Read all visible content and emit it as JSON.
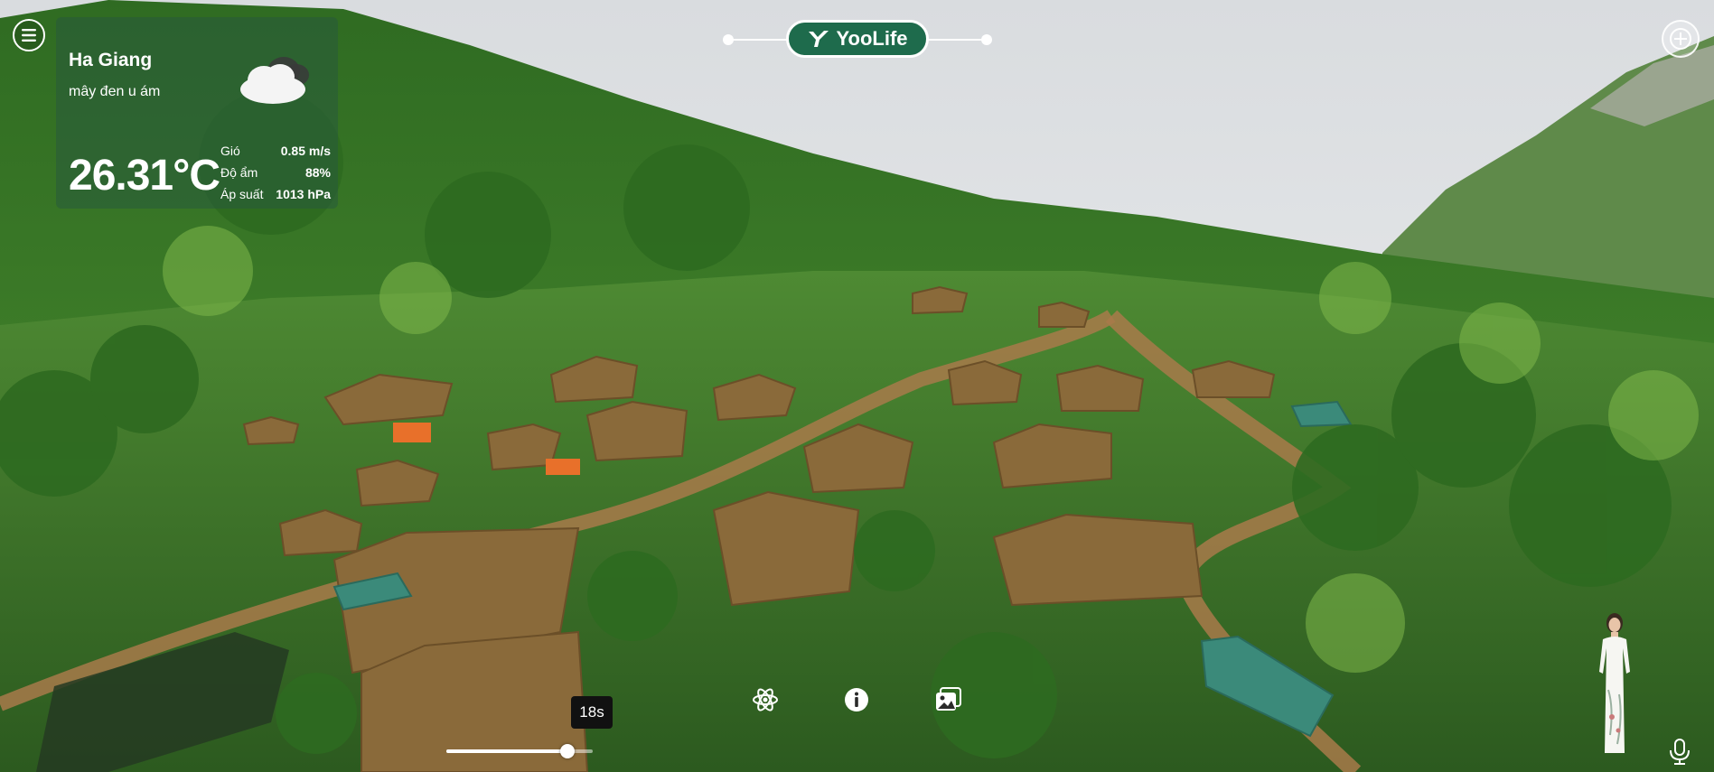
{
  "brand": {
    "name": "YooLife"
  },
  "weather": {
    "city": "Ha Giang",
    "description": "mây đen u ám",
    "temperature": "26.31°C",
    "stats": [
      {
        "label": "Gió",
        "value": "0.85 m/s"
      },
      {
        "label": "Độ ẩm",
        "value": "88%"
      },
      {
        "label": "Áp suất",
        "value": "1013 hPa"
      }
    ],
    "icon": "cloud-icon"
  },
  "player": {
    "time_label": "18s",
    "progress": 0.83
  },
  "controls": [
    {
      "name": "atom-icon"
    },
    {
      "name": "info-icon"
    },
    {
      "name": "gallery-icon"
    }
  ],
  "icons": {
    "menu": "menu-icon",
    "plus": "plus-icon",
    "mic": "microphone-icon"
  },
  "colors": {
    "brand": "#1e6b4c",
    "sky": "#e6e8ea",
    "forest": "#3d7a2e"
  }
}
